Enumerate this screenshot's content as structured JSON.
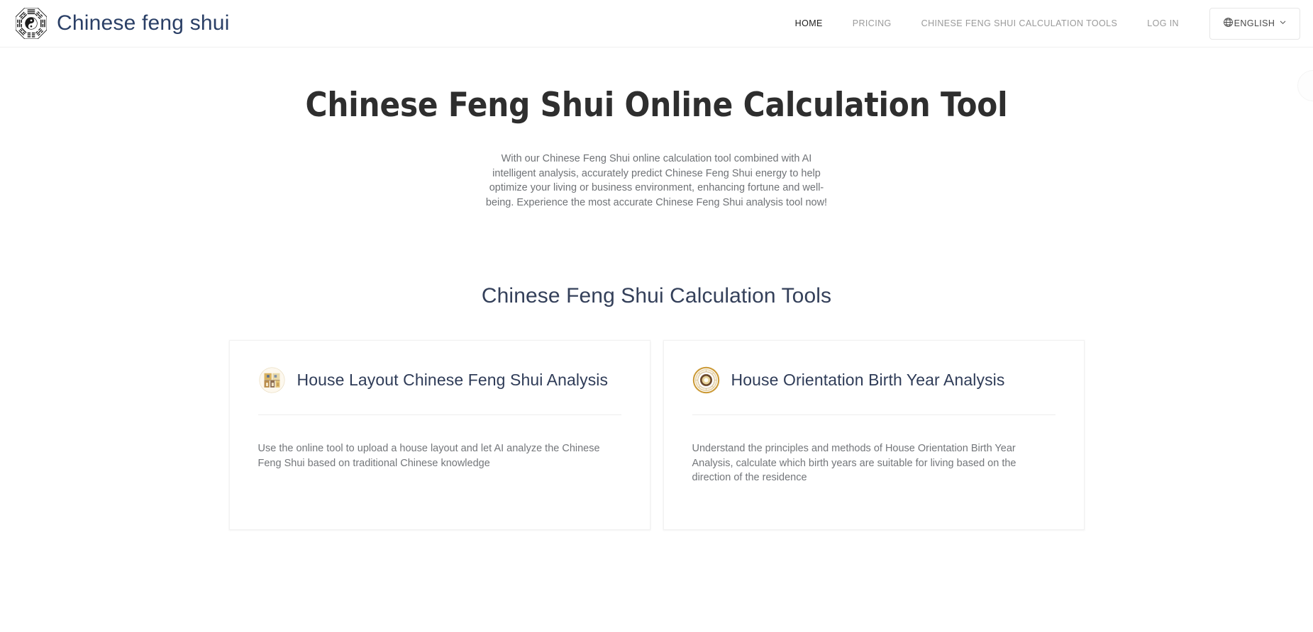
{
  "header": {
    "brand": {
      "name": "Chinese feng shui",
      "logo_icon": "bagua-icon"
    },
    "nav": [
      {
        "label": "HOME",
        "active": true
      },
      {
        "label": "PRICING",
        "active": false
      },
      {
        "label": "CHINESE FENG SHUI CALCULATION TOOLS",
        "active": false
      },
      {
        "label": "LOG IN",
        "active": false
      }
    ],
    "language": {
      "label": "ENGLISH",
      "globe_icon": "globe-icon",
      "chevron_icon": "chevron-down-icon"
    }
  },
  "hero": {
    "title": "Chinese Feng Shui Online Calculation Tool",
    "subtitle": "With our Chinese Feng Shui online calculation tool combined with AI intelligent analysis, accurately predict Chinese Feng Shui energy to help optimize your living or business environment, enhancing fortune and well-being. Experience the most accurate Chinese Feng Shui analysis tool now!"
  },
  "tools_section": {
    "heading": "Chinese Feng Shui Calculation Tools",
    "cards": [
      {
        "icon": "house-layout-icon",
        "title": "House Layout Chinese Feng Shui Analysis",
        "description": "Use the online tool to upload a house layout and let AI analyze the Chinese Feng Shui based on traditional Chinese knowledge"
      },
      {
        "icon": "luopan-compass-icon",
        "title": "House Orientation Birth Year Analysis",
        "description": "Understand the principles and methods of House Orientation Birth Year Analysis, calculate which birth years are suitable for living based on the direction of the residence"
      }
    ]
  },
  "colors": {
    "brand_text": "#2a3f66",
    "heading_dark": "#2e2e2e",
    "body_text": "#6f7276",
    "nav_inactive": "#9a9a9a",
    "nav_active": "#1d1d1d",
    "card_border": "#f2f2f2",
    "accent_gold": "#c9962f"
  }
}
